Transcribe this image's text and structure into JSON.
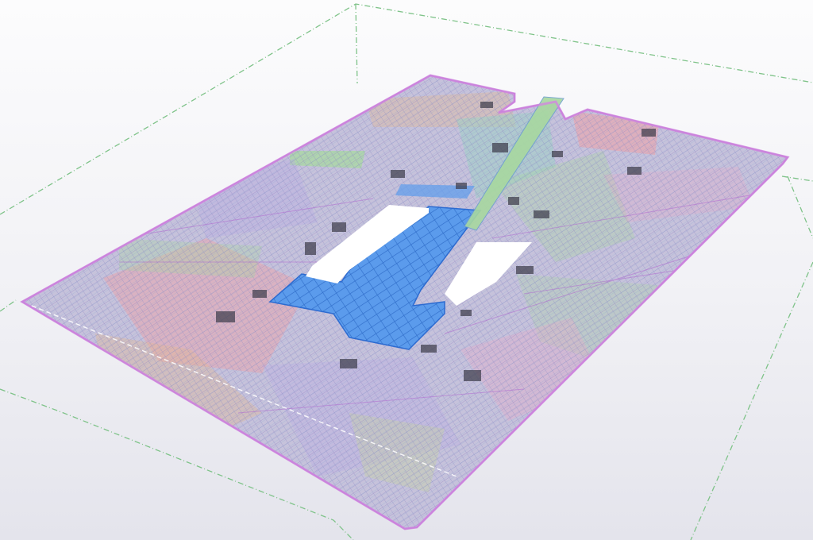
{
  "viewport": {
    "background_top": "#fcfcfd",
    "background_bottom": "#e4e4ec"
  },
  "work_area": {
    "color": "#7fc389",
    "style": "dash-dot"
  },
  "slab": {
    "base_color": "#c6c2db",
    "mesh_primary": "#8d87c4",
    "mesh_secondary": "#6f9fcf",
    "edge_color": "#b06ad0",
    "highlight_color": "#3d7fe0",
    "zone_colors": [
      "#f0a0a4",
      "#a8d8a0",
      "#e6b88c",
      "#b8a8e4",
      "#9fd0c4",
      "#e8a8c8",
      "#c8d890"
    ]
  },
  "openings": {
    "fill": "#ffffff"
  }
}
